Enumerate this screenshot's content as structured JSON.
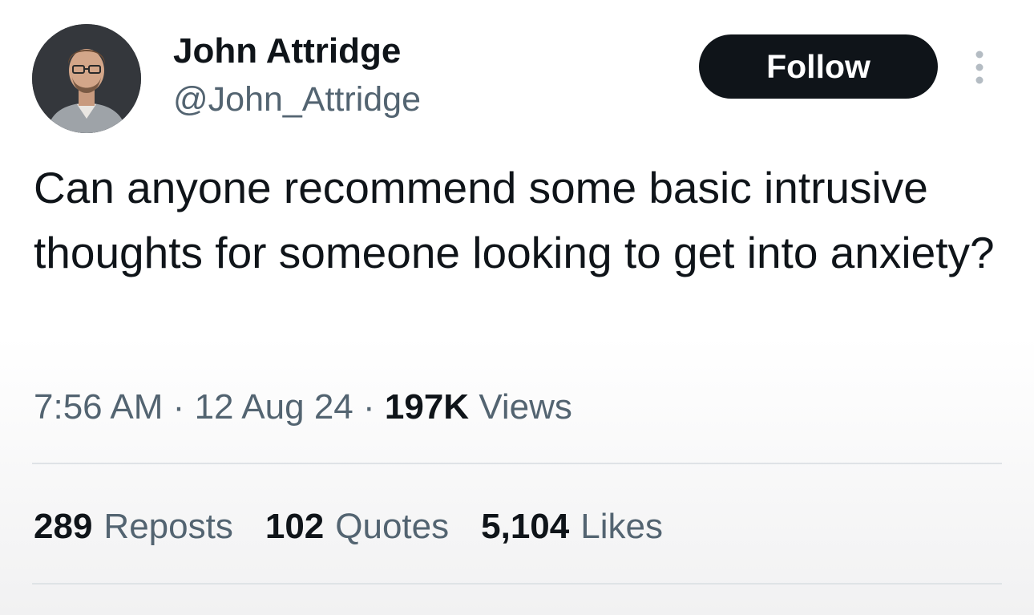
{
  "author": {
    "display_name": "John Attridge",
    "handle": "@John_Attridge",
    "avatar_icon": "profile-photo"
  },
  "follow_label": "Follow",
  "more_icon": "more-vertical-icon",
  "tweet": {
    "text": "Can anyone recommend some basic intrusive thoughts for someone looking to get into anxiety?",
    "time": "7:56 AM",
    "date": "12 Aug 24",
    "separator": "·",
    "views_count": "197K",
    "views_label": "Views"
  },
  "stats": {
    "reposts_count": "289",
    "reposts_label": "Reposts",
    "quotes_count": "102",
    "quotes_label": "Quotes",
    "likes_count": "5,104",
    "likes_label": "Likes"
  },
  "colors": {
    "text_primary": "#0f1419",
    "text_secondary": "#536471",
    "button_bg": "#0f1419",
    "button_text": "#ffffff",
    "divider": "#dfe3e6"
  }
}
